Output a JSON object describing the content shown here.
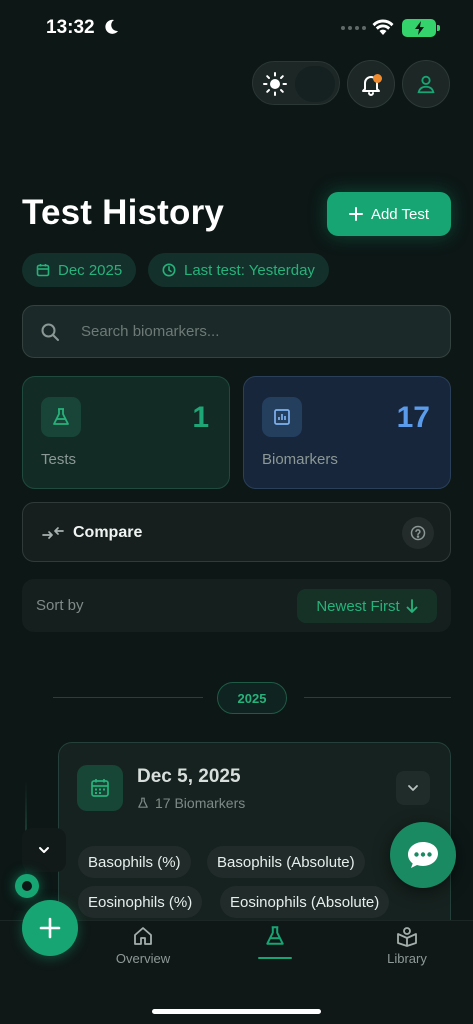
{
  "status_bar": {
    "time": "13:32"
  },
  "header": {
    "title": "Test History",
    "add_test_label": "Add Test",
    "month_chip": "Dec 2025",
    "last_test_chip": "Last test: Yesterday"
  },
  "search": {
    "placeholder": "Search biomarkers..."
  },
  "stats": {
    "tests": {
      "value": "1",
      "label": "Tests"
    },
    "biomarkers": {
      "value": "17",
      "label": "Biomarkers"
    }
  },
  "compare": {
    "label": "Compare"
  },
  "sort": {
    "label": "Sort by",
    "value": "Newest First"
  },
  "timeline": {
    "year": "2025",
    "card": {
      "date": "Dec 5, 2025",
      "count": "17 Biomarkers",
      "chips": [
        "Basophils (%)",
        "Basophils (Absolute)",
        "Eosinophils (%)",
        "Eosinophils (Absolute)"
      ]
    }
  },
  "tabs": [
    {
      "label": "Overview",
      "icon": "home-icon"
    },
    {
      "label": "",
      "icon": "flask-icon"
    },
    {
      "label": "Library",
      "icon": "book-icon"
    }
  ],
  "colors": {
    "accent": "#17a673",
    "background": "#0c1716",
    "biomarker_blue": "#5b9bec",
    "notification": "#f08a2e"
  }
}
